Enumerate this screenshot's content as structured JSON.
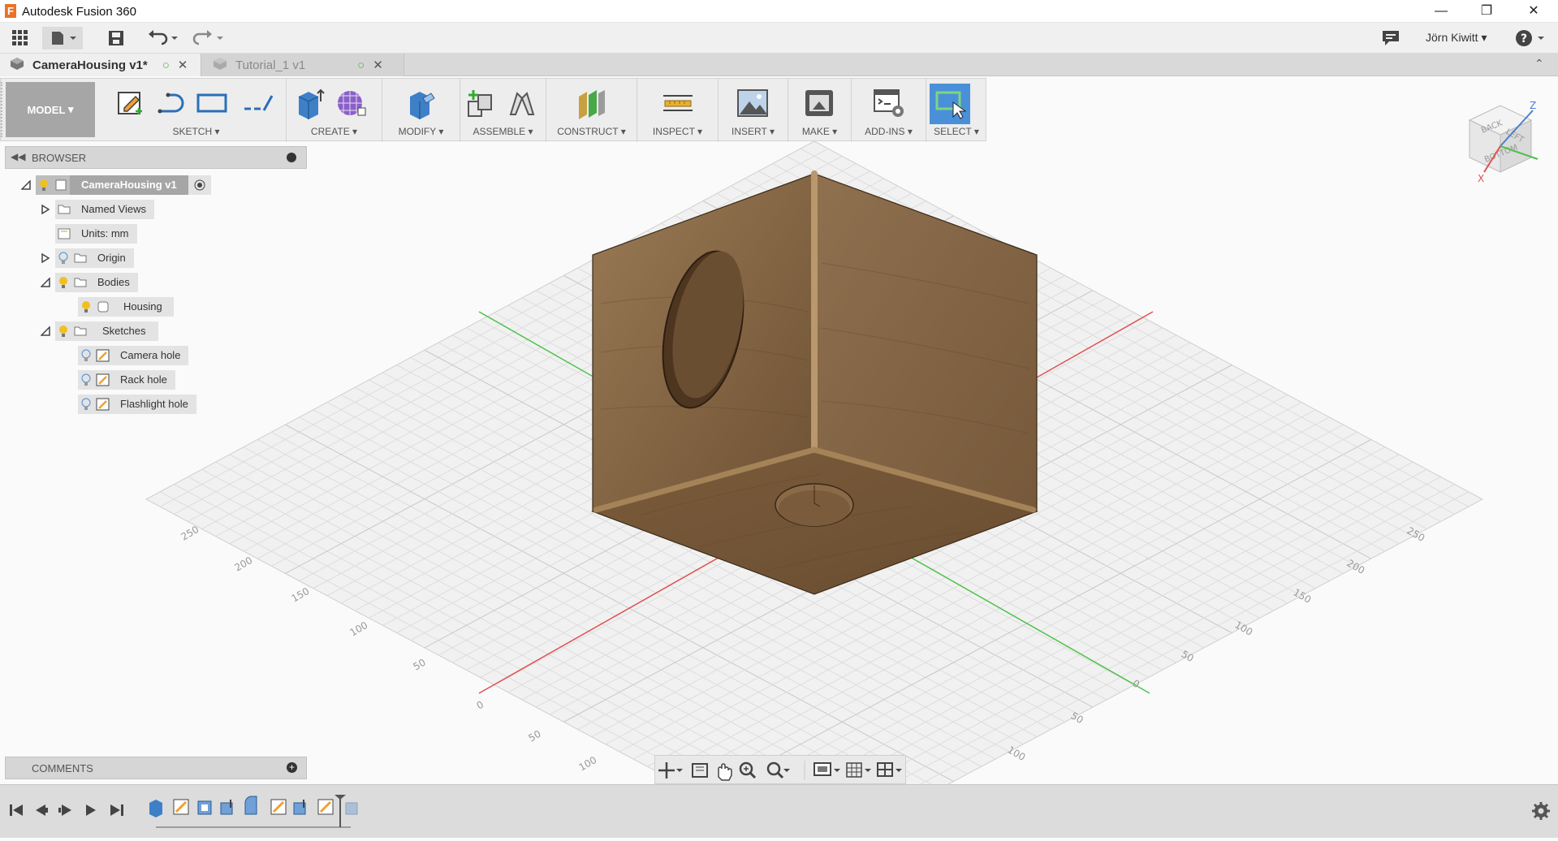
{
  "app": {
    "title": "Autodesk Fusion 360",
    "logo_letter": "F"
  },
  "user": {
    "name": "Jörn Kiwitt"
  },
  "tabs": [
    {
      "label": "CameraHousing v1*",
      "active": true
    },
    {
      "label": "Tutorial_1 v1",
      "active": false
    }
  ],
  "toolbar": {
    "mode": "MODEL",
    "groups": [
      "SKETCH",
      "CREATE",
      "MODIFY",
      "ASSEMBLE",
      "CONSTRUCT",
      "INSPECT",
      "INSERT",
      "MAKE",
      "ADD-INS",
      "SELECT"
    ]
  },
  "browser": {
    "title": "BROWSER",
    "root": "CameraHousing v1",
    "items": [
      "Named Views",
      "Units: mm",
      "Origin",
      "Bodies",
      "Housing",
      "Sketches",
      "Camera hole",
      "Rack hole",
      "Flashlight hole"
    ]
  },
  "comments": {
    "title": "COMMENTS"
  },
  "viewcube": {
    "faces": [
      "BACK",
      "LEFT",
      "BOTTOM"
    ],
    "axes": [
      "Z",
      "X"
    ]
  },
  "grid": {
    "left_labels": [
      "250",
      "200",
      "150",
      "100",
      "50",
      "0",
      "50",
      "100"
    ],
    "right_labels": [
      "250",
      "200",
      "150",
      "100",
      "50",
      "0",
      "50",
      "100"
    ]
  },
  "colors": {
    "accent": "#4a90d9",
    "wood": "#8a6a47",
    "toolbar_bg": "#ededed",
    "x_axis": "#e05050",
    "y_axis": "#4ec24e"
  }
}
